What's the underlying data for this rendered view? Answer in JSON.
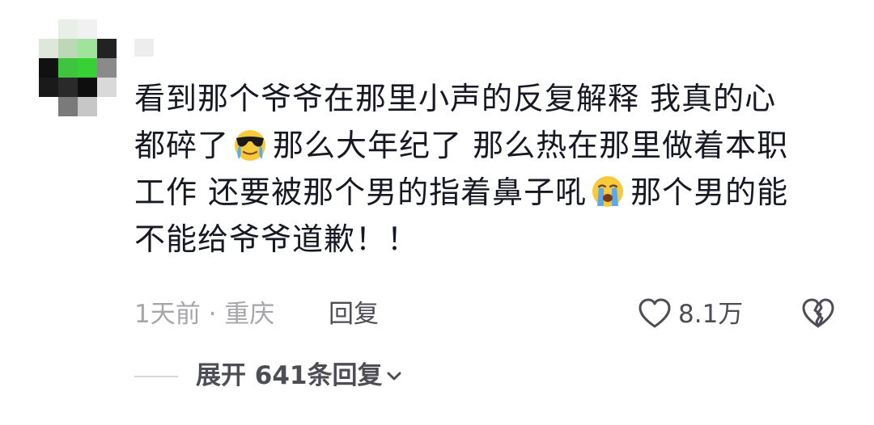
{
  "comment": {
    "lines": [
      "看到那个爷爷在那里小声的反复解释 我真的心",
      "都碎了",
      "那么大年纪了 那么热在那里做着本职",
      "工作 还要被那个男的指着鼻子吼",
      "那个男的能",
      "不能给爷爷道歉！！"
    ],
    "emoji_1": "sunglasses-crying-emoji",
    "emoji_2": "loudly-crying-emoji"
  },
  "meta": {
    "time_location": "1天前 · 重庆",
    "reply_label": "回复",
    "like_count": "8.1万",
    "like_icon": "heart-outline-icon",
    "dislike_icon": "broken-heart-icon"
  },
  "expand": {
    "label": "展开 641条回复",
    "icon": "chevron-down-icon"
  },
  "colors": {
    "text_primary": "#161823",
    "text_secondary": "#a6a6ab",
    "text_action": "#4d4d55"
  }
}
